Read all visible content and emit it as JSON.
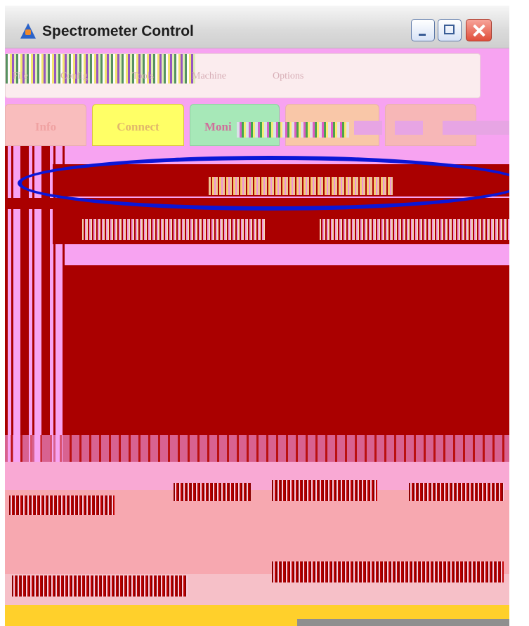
{
  "window": {
    "title": "Spectrometer Control",
    "icon": "app-logo-icon",
    "controls": [
      "minimize-icon",
      "maximize-icon",
      "close-icon"
    ]
  },
  "menu": {
    "items": [
      "File",
      "Config",
      "Tools",
      "Machine",
      "Options"
    ]
  },
  "tabs": [
    {
      "label": "Info"
    },
    {
      "label": "Connect"
    },
    {
      "label": "Moni"
    },
    {
      "label": ""
    },
    {
      "label": ""
    }
  ],
  "colors": {
    "background": "#f7a3f1",
    "dark_red": "#aa0000",
    "highlight_ellipse": "#0b16d6",
    "tab_info": "#f9bdbd",
    "tab_connect": "#ffff66",
    "tab_monitor": "#a7e8b8"
  }
}
